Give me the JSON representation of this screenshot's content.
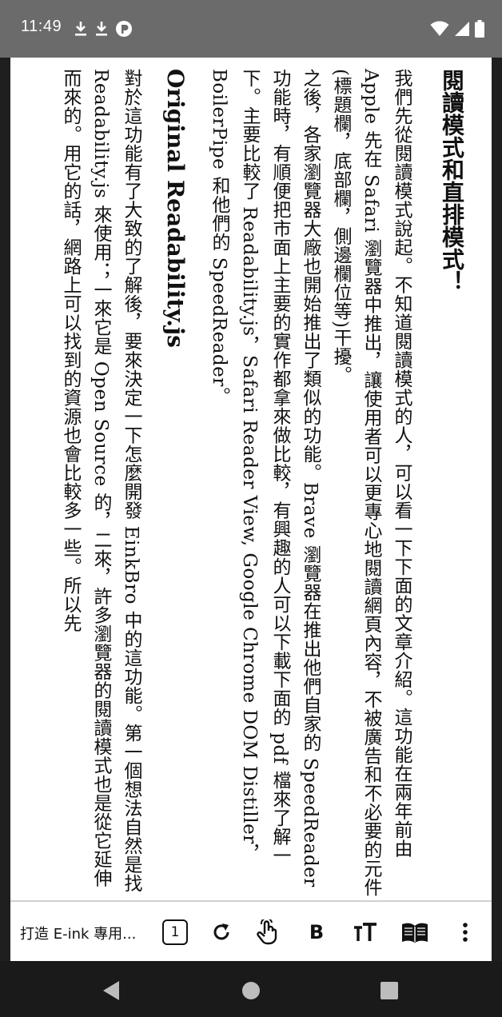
{
  "status_bar": {
    "time": "11:49",
    "left_icons": [
      "download-icon",
      "download-icon",
      "app-notification-icon"
    ],
    "right_icons": [
      "wifi-icon",
      "cell-signal-icon",
      "battery-icon"
    ]
  },
  "article": {
    "heading": "閱讀模式和直排模式！",
    "paragraphs": [
      "我們先從閱讀模式說起。不知道閱讀模式的人，可以看一下下面的文章介紹。這功能在兩年前由 Apple 先在 Safari 瀏覽器中推出，讓使用者可以更專心地閱讀網頁內容，不被廣告和不必要的元件(標題欄，底部欄，側邊欄位等)干擾。",
      "之後，各家瀏覽器大廠也開始推出了類似的功能。Brave 瀏覽器在推出他們自家的 SpeedReader 功能時，有順便把市面上主要的實作都拿來做比較，有興趣的人可以下載下面的 pdf 檔來了解一下。主要比較了 Readability.js，Safari Reader View, Google Chrome DOM Distiller，BoilerPipe 和他們的 SpeedReader。"
    ],
    "subheading": "Original Readability.js",
    "paragraph3": "對於這功能有了大致的了解後，要來決定一下怎麼開發 EinkBro 中的這功能。第一個想法自然是找 Readability.js 來使用；一來它是 Open Source 的，二來，許多瀏覽器的閱讀模式也是從它延伸而來的。用它的話，網路上可以找到的資源也會比較多一些。所以先"
  },
  "toolbar": {
    "tab_title": "打造 E-ink 專用...",
    "page_count": "1",
    "bold_label": "B"
  },
  "nav_bar": {
    "icons": [
      "back-icon",
      "home-icon",
      "recents-icon"
    ]
  }
}
